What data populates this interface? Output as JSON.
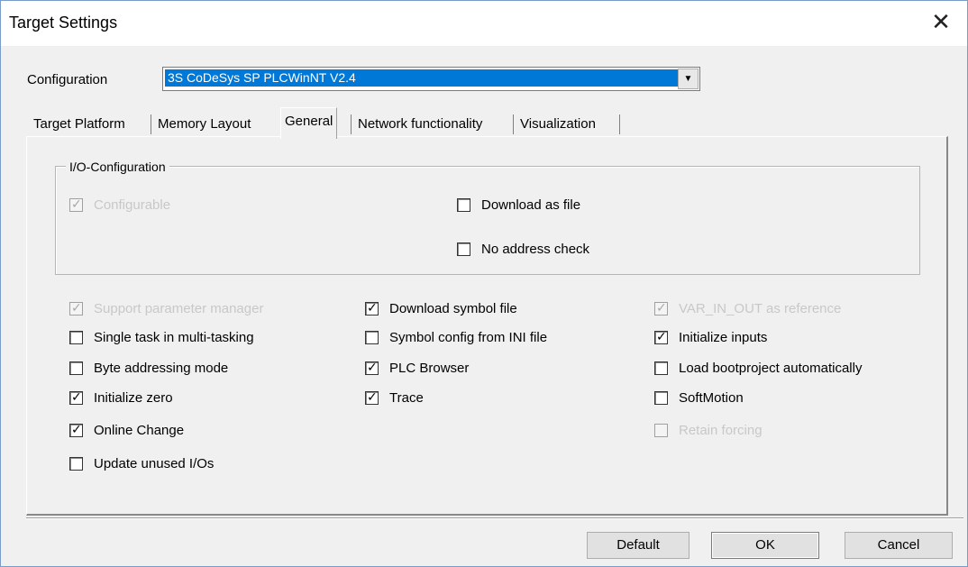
{
  "window": {
    "title": "Target Settings",
    "close_glyph": "✕"
  },
  "config": {
    "label": "Configuration",
    "value": "3S CoDeSys SP PLCWinNT V2.4",
    "arrow": "▼"
  },
  "tabs": [
    {
      "label": "Target Platform"
    },
    {
      "label": "Memory Layout"
    },
    {
      "label": "General",
      "active": true
    },
    {
      "label": "Network functionality"
    },
    {
      "label": "Visualization"
    }
  ],
  "io_group": {
    "title": "I/O-Configuration",
    "items": [
      {
        "label": "Configurable",
        "checked": true,
        "enabled": false
      },
      {
        "label": "Download as file",
        "checked": false,
        "enabled": true
      },
      {
        "label": "No address check",
        "checked": false,
        "enabled": true
      }
    ]
  },
  "col1": [
    {
      "label": "Support parameter manager",
      "checked": true,
      "enabled": false
    },
    {
      "label": "Single task in multi-tasking",
      "checked": false,
      "enabled": true
    },
    {
      "label": "Byte addressing mode",
      "checked": false,
      "enabled": true
    },
    {
      "label": "Initialize zero",
      "checked": true,
      "enabled": true
    },
    {
      "label": "Online Change",
      "checked": true,
      "enabled": true
    },
    {
      "label": "Update unused I/Os",
      "checked": false,
      "enabled": true
    }
  ],
  "col2": [
    {
      "label": "Download symbol file",
      "checked": true,
      "enabled": true
    },
    {
      "label": "Symbol config from INI file",
      "checked": false,
      "enabled": true
    },
    {
      "label": "PLC Browser",
      "checked": true,
      "enabled": true
    },
    {
      "label": "Trace",
      "checked": true,
      "enabled": true
    }
  ],
  "col3": [
    {
      "label": "VAR_IN_OUT as reference",
      "checked": true,
      "enabled": false
    },
    {
      "label": "Initialize inputs",
      "checked": true,
      "enabled": true
    },
    {
      "label": "Load bootproject automatically",
      "checked": false,
      "enabled": true
    },
    {
      "label": "SoftMotion",
      "checked": false,
      "enabled": true
    },
    {
      "label": "Retain forcing",
      "checked": false,
      "enabled": false
    }
  ],
  "buttons": {
    "default": "Default",
    "ok": "OK",
    "cancel": "Cancel"
  },
  "check_glyph": "✓"
}
